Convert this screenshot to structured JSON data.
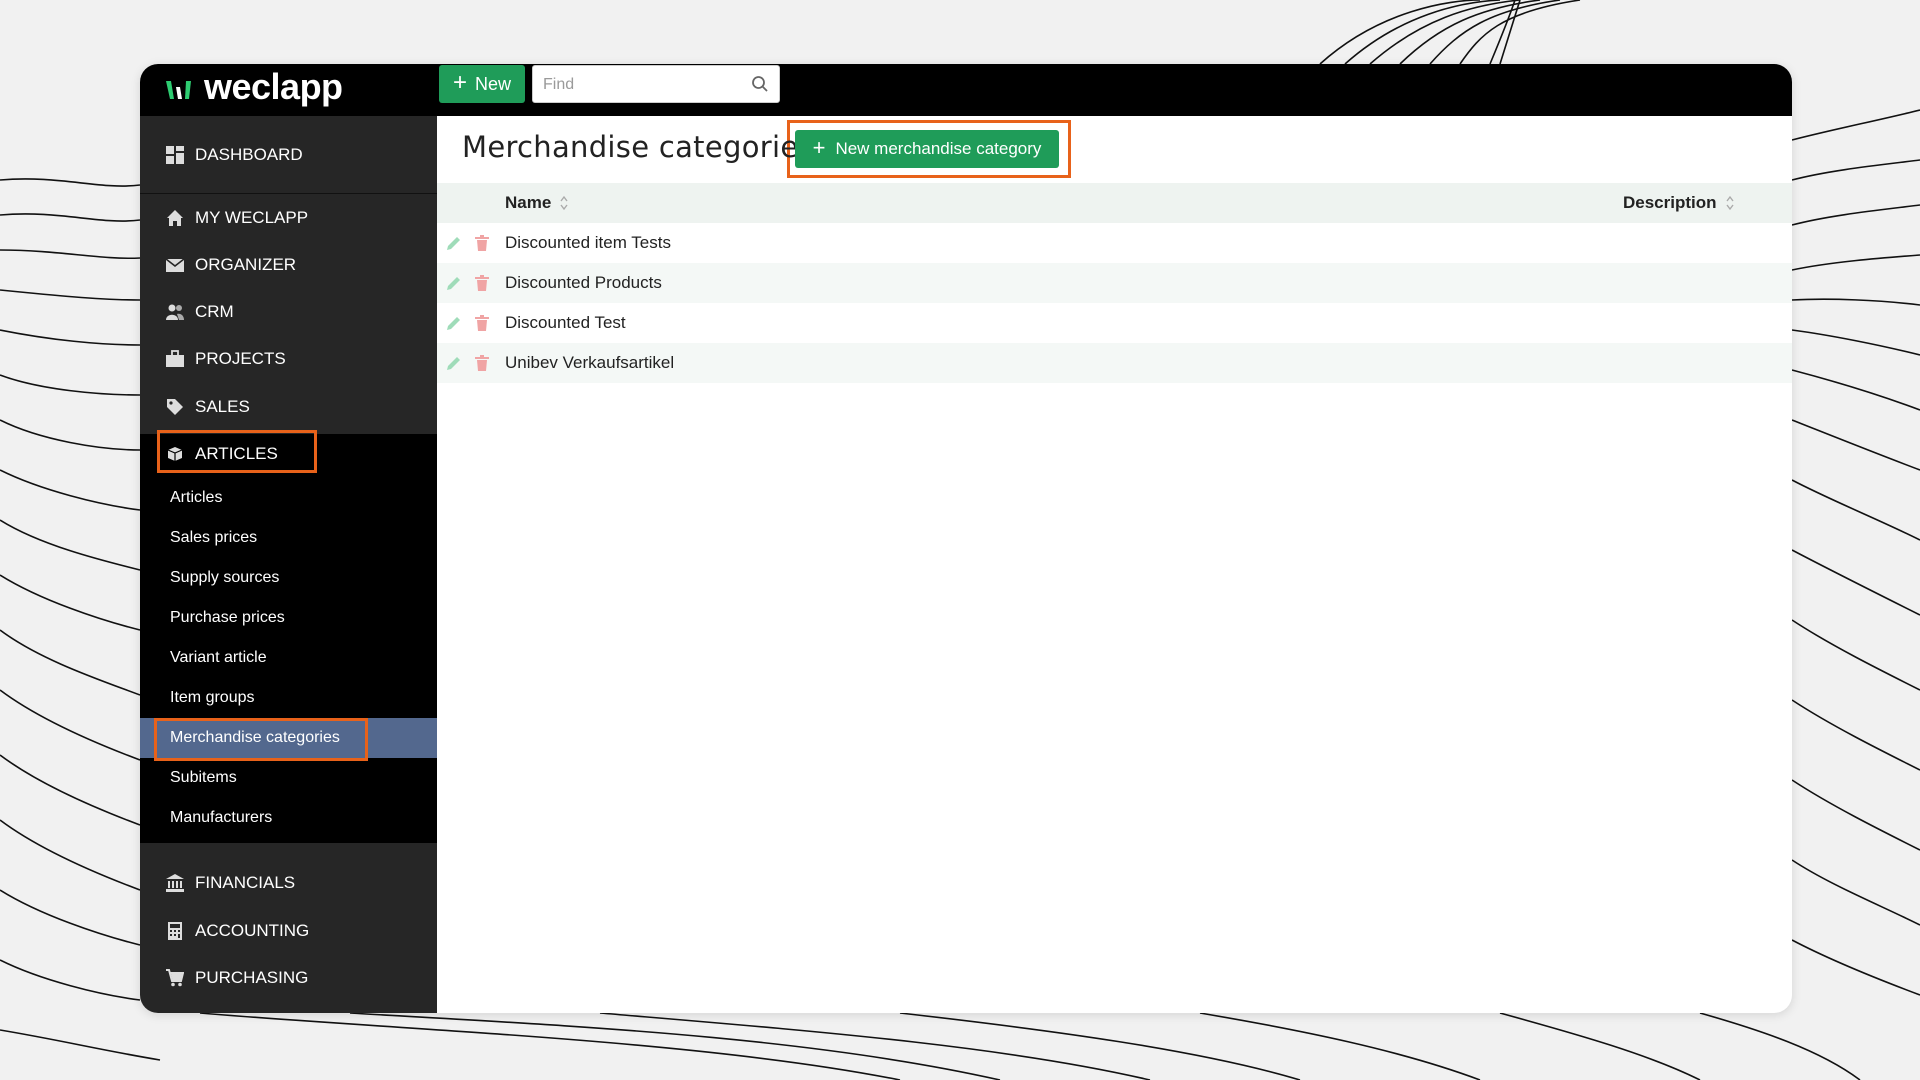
{
  "topbar": {
    "logo_text": "weclapp",
    "new_button_label": "New",
    "find_placeholder": "Find"
  },
  "sidebar": {
    "dashboard": "DASHBOARD",
    "items": [
      {
        "label": "MY WECLAPP",
        "icon": "home-icon"
      },
      {
        "label": "ORGANIZER",
        "icon": "envelope-icon"
      },
      {
        "label": "CRM",
        "icon": "users-icon"
      },
      {
        "label": "PROJECTS",
        "icon": "briefcase-icon"
      },
      {
        "label": "SALES",
        "icon": "tag-icon"
      },
      {
        "label": "ARTICLES",
        "icon": "box-icon"
      }
    ],
    "articles_submenu": [
      "Articles",
      "Sales prices",
      "Supply sources",
      "Purchase prices",
      "Variant article",
      "Item groups",
      "Merchandise categories",
      "Subitems",
      "Manufacturers"
    ],
    "active_submenu_item": "Merchandise categories",
    "bottom_items": [
      {
        "label": "FINANCIALS",
        "icon": "bank-icon"
      },
      {
        "label": "ACCOUNTING",
        "icon": "calculator-icon"
      },
      {
        "label": "PURCHASING",
        "icon": "cart-icon"
      }
    ]
  },
  "main": {
    "title": "Merchandise categories",
    "new_category_button": "New merchandise category",
    "table": {
      "columns": [
        "Name",
        "Description"
      ],
      "rows": [
        {
          "name": "Discounted item Tests",
          "description": ""
        },
        {
          "name": "Discounted Products",
          "description": ""
        },
        {
          "name": "Discounted Test",
          "description": ""
        },
        {
          "name": "Unibev Verkaufsartikel",
          "description": ""
        }
      ]
    }
  },
  "colors": {
    "primary_green": "#1f9c59",
    "highlight_orange": "#e8621a",
    "sidebar_bg": "#262626",
    "active_item_bg": "#53688e"
  }
}
